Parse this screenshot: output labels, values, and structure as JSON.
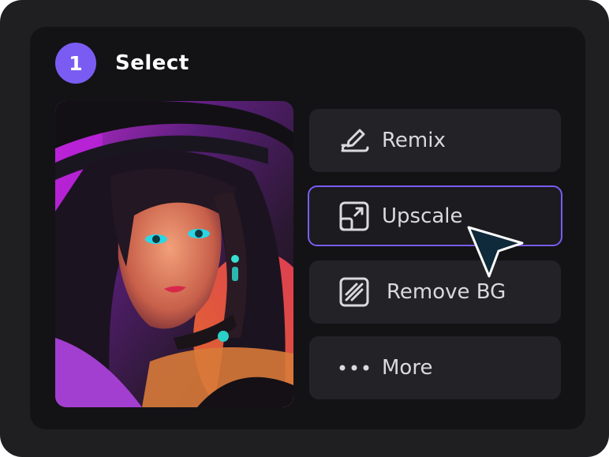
{
  "step": {
    "number": "1",
    "title": "Select"
  },
  "actions": [
    {
      "label": "Remix",
      "icon": "pen-line-icon"
    },
    {
      "label": "Upscale",
      "icon": "expand-arrow-icon",
      "highlighted": true
    },
    {
      "label": "Remove BG",
      "icon": "hatched-square-icon"
    },
    {
      "label": "More",
      "icon": "dots-icon"
    }
  ],
  "image": {
    "icon": "portrait-thumbnail"
  },
  "colors": {
    "accent": "#7b5cf2",
    "panel": "#131316",
    "outer": "#1f1f22",
    "button": "#232327",
    "text": "#d9d9de"
  }
}
